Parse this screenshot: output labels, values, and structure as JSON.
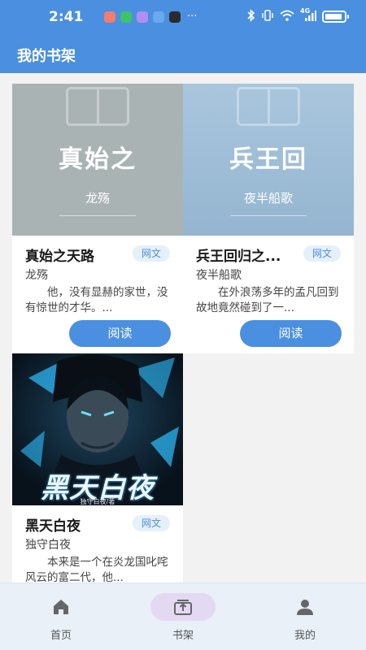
{
  "status_bar": {
    "time": "2:41",
    "more": "···",
    "network": "4G"
  },
  "header": {
    "title": "我的书架"
  },
  "books": [
    {
      "cover_title": "真始之",
      "cover_author": "龙殇",
      "title": "真始之天路",
      "tag": "网文",
      "author": "龙殇",
      "description": "他，没有显赫的家世，没有惊世的才华。...",
      "read_label": "阅读"
    },
    {
      "cover_title": "兵王回",
      "cover_author": "夜半船歌",
      "title": "兵王回归之...",
      "tag": "网文",
      "author": "夜半船歌",
      "description": "在外浪荡多年的孟凡回到故地竟然碰到了一...",
      "read_label": "阅读"
    },
    {
      "cover_title": "黑天白夜",
      "cover_subtitle": "独守白夜/著",
      "title": "黑天白夜",
      "tag": "网文",
      "author": "独守白夜",
      "description": "本来是一个在炎龙国叱咤风云的富二代，他..."
    }
  ],
  "tabbar": {
    "items": [
      {
        "label": "首页",
        "icon": "home-icon"
      },
      {
        "label": "书架",
        "icon": "bookshelf-icon",
        "active": true
      },
      {
        "label": "我的",
        "icon": "user-icon"
      }
    ]
  },
  "colors": {
    "primary": "#4a8fe0",
    "tag_bg": "#e6f0fb",
    "active_pill": "#e4d9f3"
  }
}
